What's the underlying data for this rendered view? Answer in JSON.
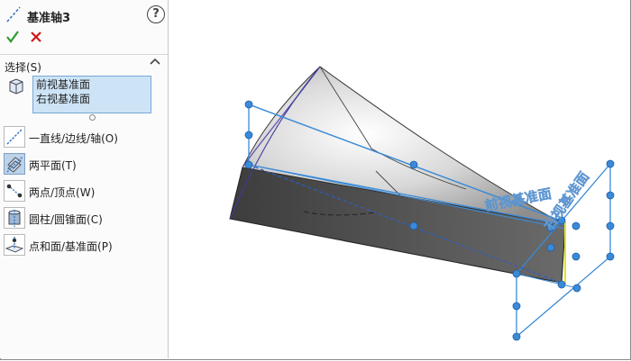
{
  "panel": {
    "title": "基准轴3",
    "help_label": "?",
    "ok_icon": "check-icon",
    "cancel_icon": "x-icon",
    "section_title": "选择(S)",
    "selections": [
      "前视基准面",
      "右视基准面"
    ],
    "options": [
      {
        "label": "一直线/边线/轴(O)",
        "icon": "line-edge-axis-icon",
        "active": false
      },
      {
        "label": "两平面(T)",
        "icon": "two-planes-icon",
        "active": true
      },
      {
        "label": "两点/顶点(W)",
        "icon": "two-points-icon",
        "active": false
      },
      {
        "label": "圆柱/圆锥面(C)",
        "icon": "cylinder-cone-icon",
        "active": false
      },
      {
        "label": "点和面/基准面(P)",
        "icon": "point-plane-icon",
        "active": false
      }
    ]
  },
  "viewport": {
    "plane_labels": [
      "前视基准面",
      "右视基准面"
    ]
  },
  "colors": {
    "accent": "#3a8ad8",
    "ok": "#2f9a2f",
    "cancel": "#d01818",
    "selection_bg": "#cde4f7"
  }
}
